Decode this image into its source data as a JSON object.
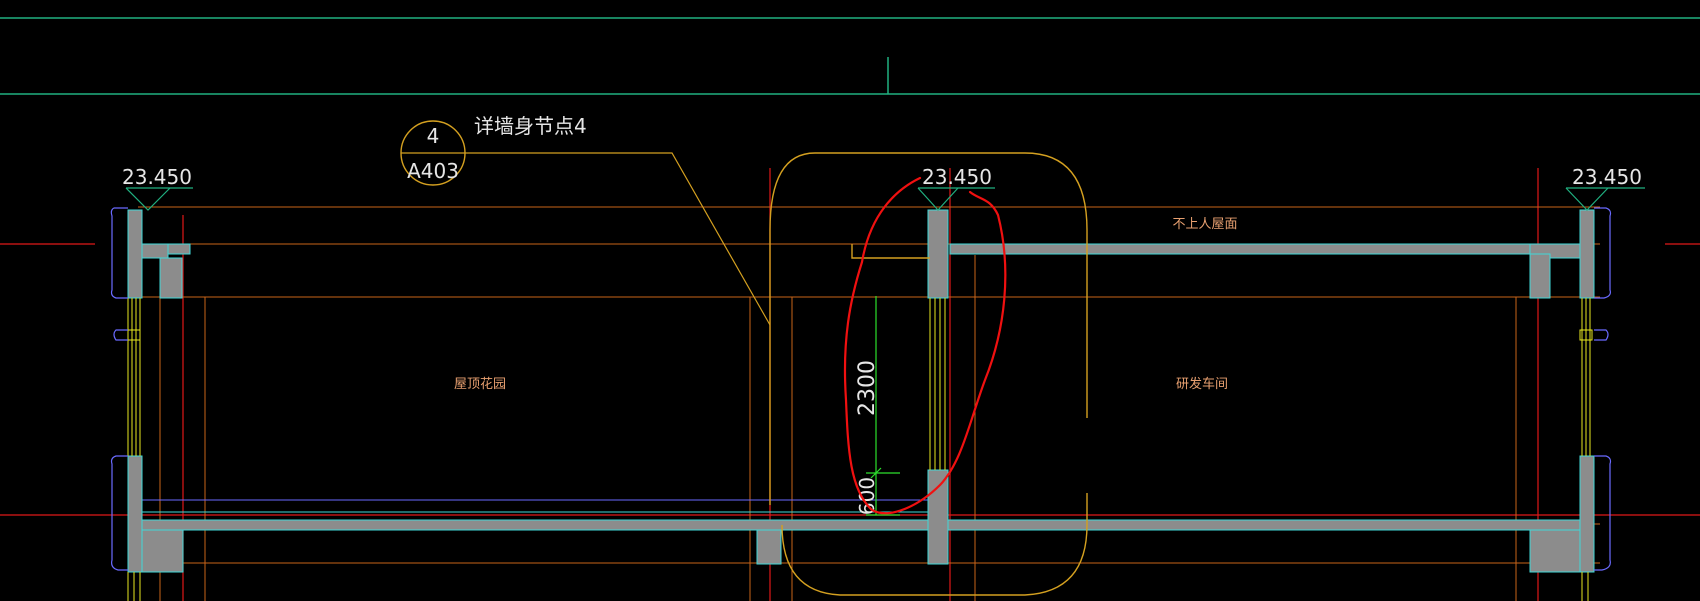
{
  "drawing": {
    "background": "#000000",
    "colors": {
      "slab_fill": "#8c8c8c",
      "outline_cyan": "#3fd8d8",
      "axis_red": "#e01818",
      "grid_orange": "#c86418",
      "dim_green": "#2ce02c",
      "teal_line": "#20b080",
      "window_yellow": "#e8e820",
      "trim_blue": "#6a6aff",
      "detail_gold": "#d4a020",
      "markup_red": "#f01010",
      "text_white": "#e6e6e6",
      "room_label": "#e8a070"
    }
  },
  "detail_callout": {
    "number": "4",
    "sheet": "A403",
    "note": "详墙身节点4"
  },
  "elevations": {
    "left": "23.450",
    "center": "23.450",
    "right": "23.450"
  },
  "rooms": {
    "roof_garden": "屋顶花园",
    "rd_workshop": "研发车间",
    "roof_note": "不上人屋面"
  },
  "dimensions": {
    "vertical_main": "2300",
    "vertical_small": "600"
  }
}
